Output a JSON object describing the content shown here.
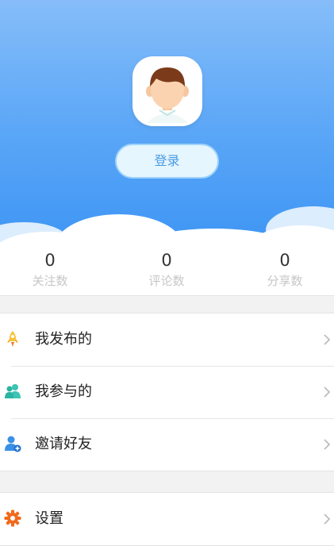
{
  "profile": {
    "login_label": "登录"
  },
  "stats": [
    {
      "value": "0",
      "label": "关注数"
    },
    {
      "value": "0",
      "label": "评论数"
    },
    {
      "value": "0",
      "label": "分享数"
    }
  ],
  "menu": [
    {
      "label": "我发布的",
      "icon": "rocket-icon"
    },
    {
      "label": "我参与的",
      "icon": "users-icon"
    },
    {
      "label": "邀请好友",
      "icon": "add-user-icon"
    }
  ],
  "menu2": [
    {
      "label": "设置",
      "icon": "gear-icon"
    }
  ],
  "colors": {
    "header_top": "#86bdf9",
    "header_bottom": "#3f96f4",
    "login_text": "#4a9be4"
  }
}
